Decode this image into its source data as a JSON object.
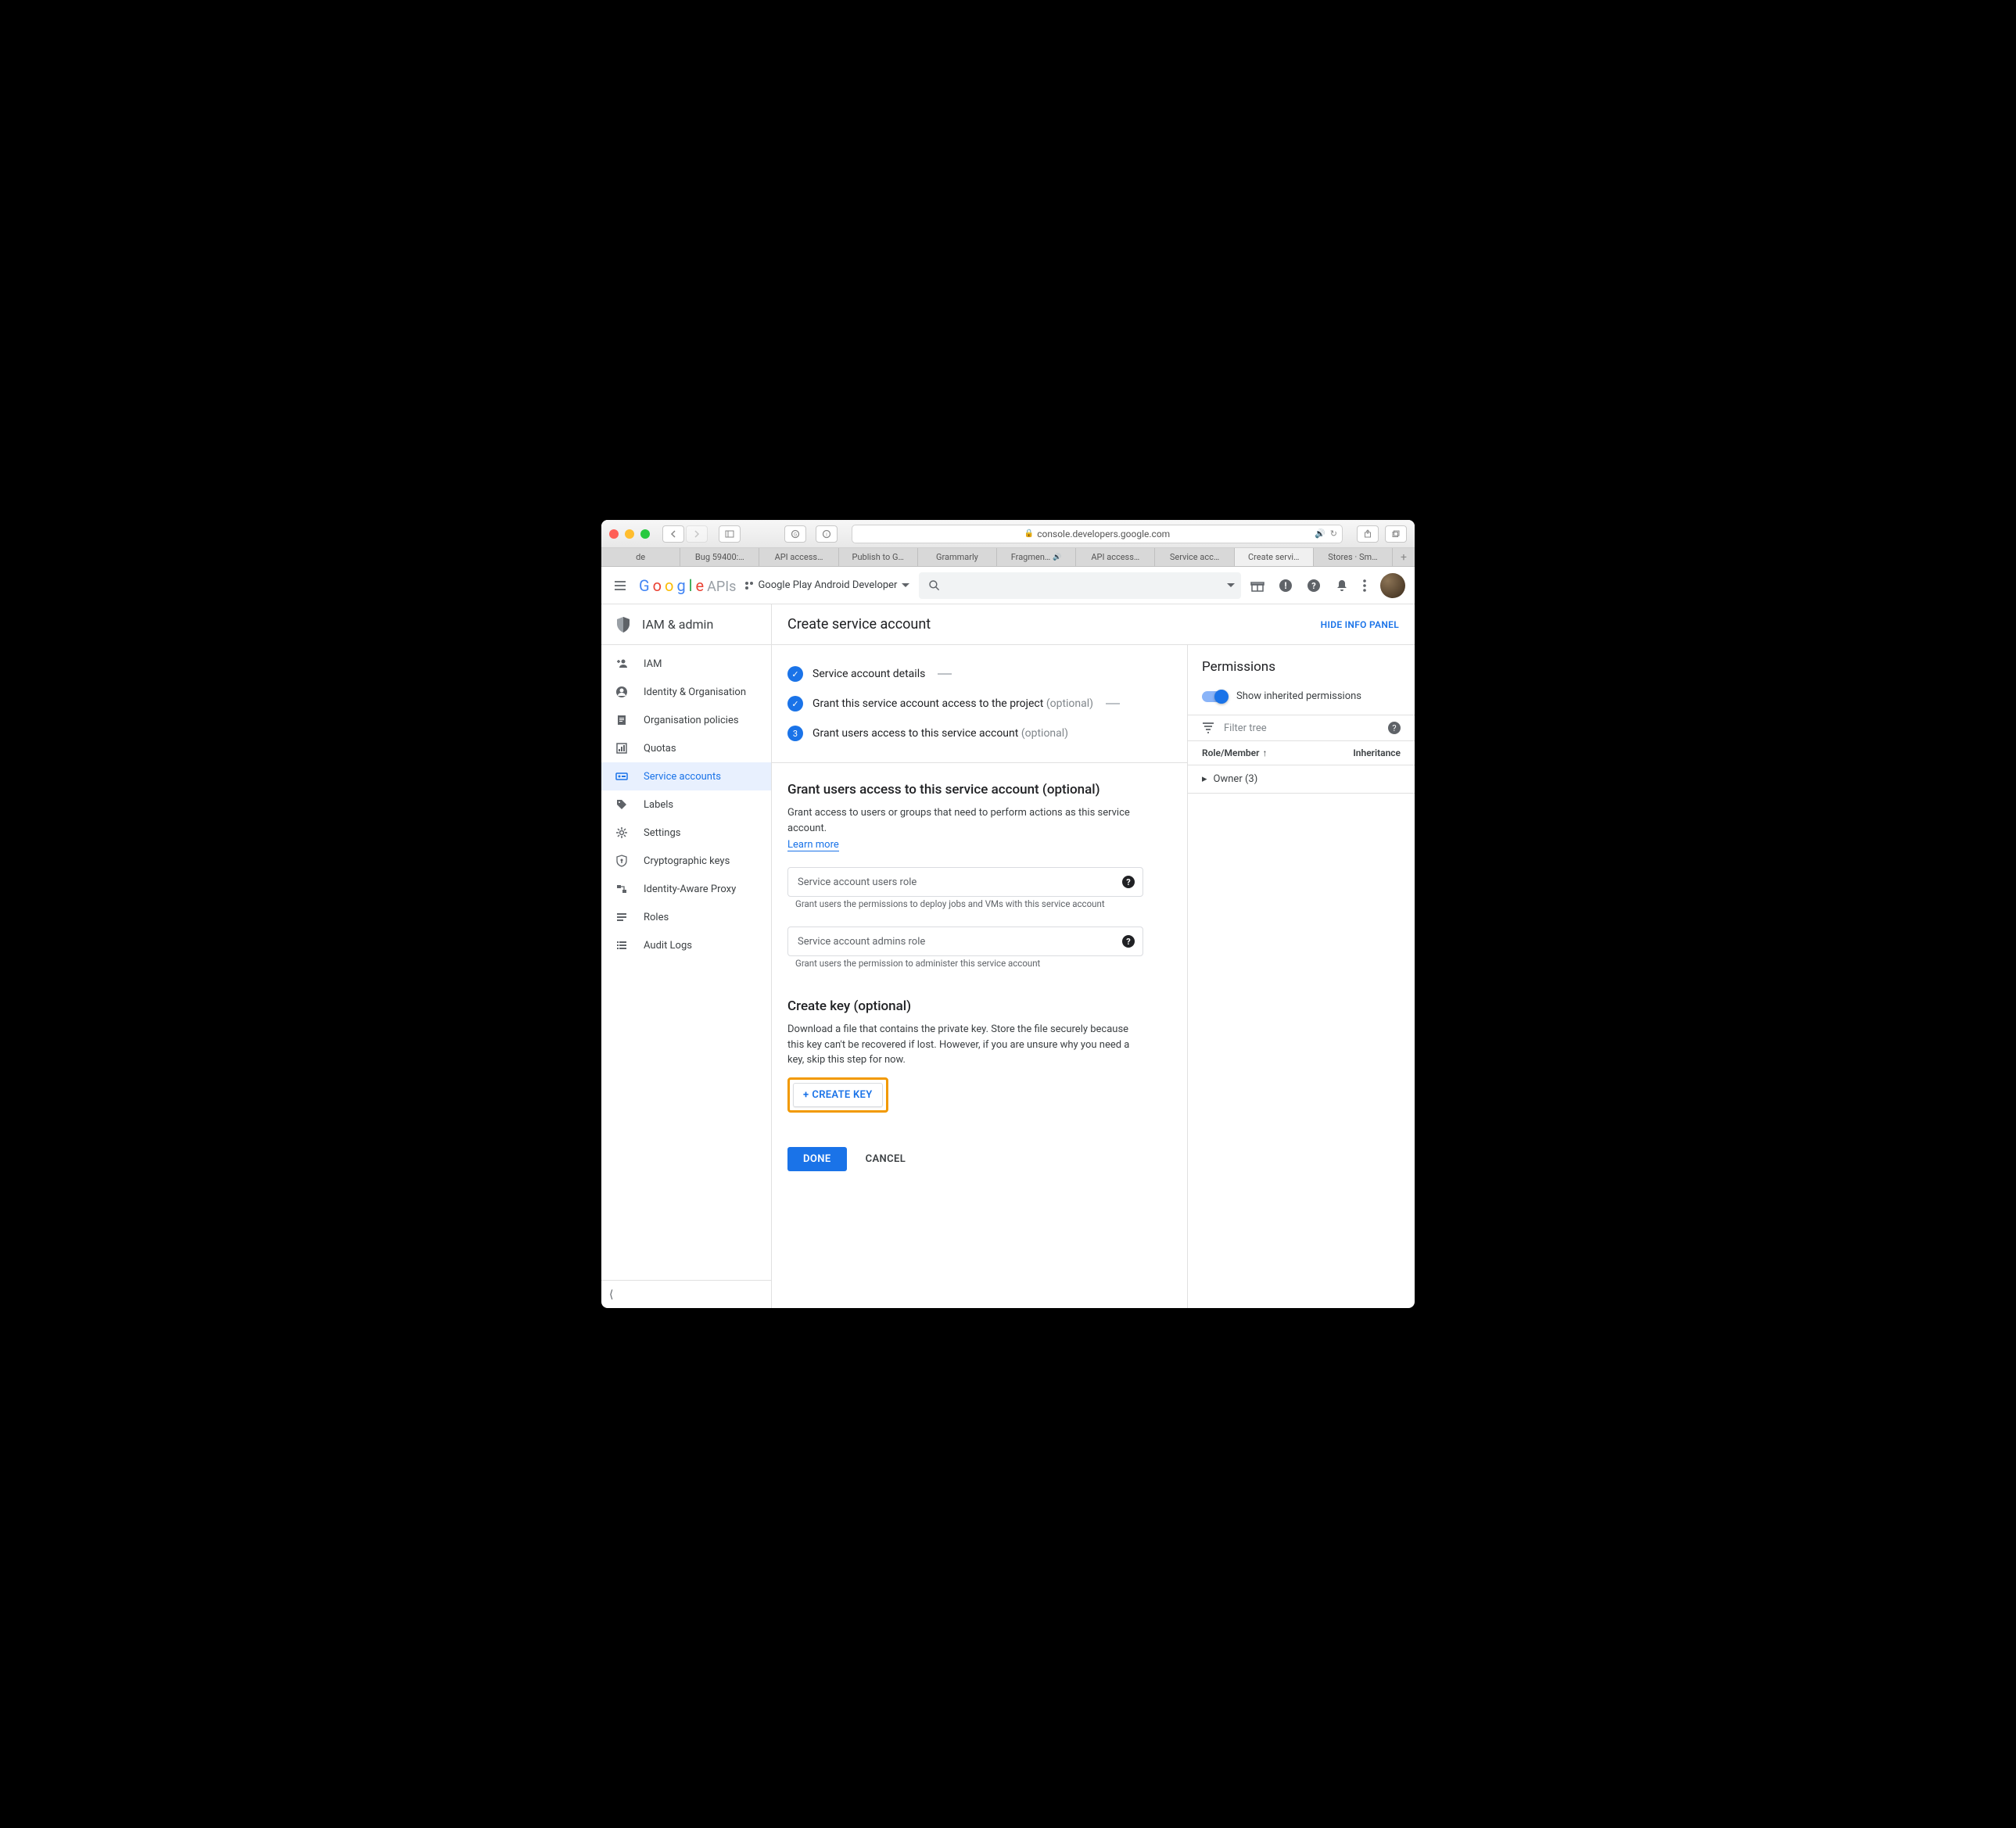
{
  "browser": {
    "url": "console.developers.google.com",
    "tabs": [
      "de",
      "Bug 59400:…",
      "API access…",
      "Publish to G…",
      "Grammarly",
      "Fragmen…",
      "API access…",
      "Service acc…",
      "Create servi…",
      "Stores · Sm…"
    ],
    "tab_audio": [
      false,
      false,
      false,
      false,
      false,
      true,
      false,
      false,
      false,
      false
    ],
    "active_tab_index": 8
  },
  "header": {
    "logo_text": "Google",
    "logo_suffix": "APIs",
    "project": "Google Play Android Developer"
  },
  "sidebar": {
    "title": "IAM & admin",
    "items": [
      {
        "label": "IAM"
      },
      {
        "label": "Identity & Organisation"
      },
      {
        "label": "Organisation policies"
      },
      {
        "label": "Quotas"
      },
      {
        "label": "Service accounts"
      },
      {
        "label": "Labels"
      },
      {
        "label": "Settings"
      },
      {
        "label": "Cryptographic keys"
      },
      {
        "label": "Identity-Aware Proxy"
      },
      {
        "label": "Roles"
      },
      {
        "label": "Audit Logs"
      }
    ],
    "active_index": 4
  },
  "main": {
    "title": "Create service account",
    "hide_panel": "HIDE INFO PANEL",
    "steps": [
      {
        "label": "Service account details",
        "optional": "",
        "done": true
      },
      {
        "label": "Grant this service account access to the project",
        "optional": "(optional)",
        "done": true
      },
      {
        "label": "Grant users access to this service account",
        "optional": "(optional)",
        "done": false,
        "num": "3"
      }
    ],
    "grant_section": {
      "heading": "Grant users access to this service account (optional)",
      "desc": "Grant access to users or groups that need to perform actions as this service account.",
      "learn_more": "Learn more",
      "field1_label": "Service account users role",
      "field1_help": "Grant users the permissions to deploy jobs and VMs with this service account",
      "field2_label": "Service account admins role",
      "field2_help": "Grant users the permission to administer this service account"
    },
    "key_section": {
      "heading": "Create key (optional)",
      "desc": "Download a file that contains the private key. Store the file securely because this key can't be recovered if lost. However, if you are unsure why you need a key, skip this step for now.",
      "button": "CREATE KEY"
    },
    "actions": {
      "done": "DONE",
      "cancel": "CANCEL"
    }
  },
  "permissions": {
    "title": "Permissions",
    "toggle_label": "Show inherited permissions",
    "filter_placeholder": "Filter tree",
    "col_role": "Role/Member",
    "col_inh": "Inheritance",
    "row_owner": "Owner (3)"
  }
}
